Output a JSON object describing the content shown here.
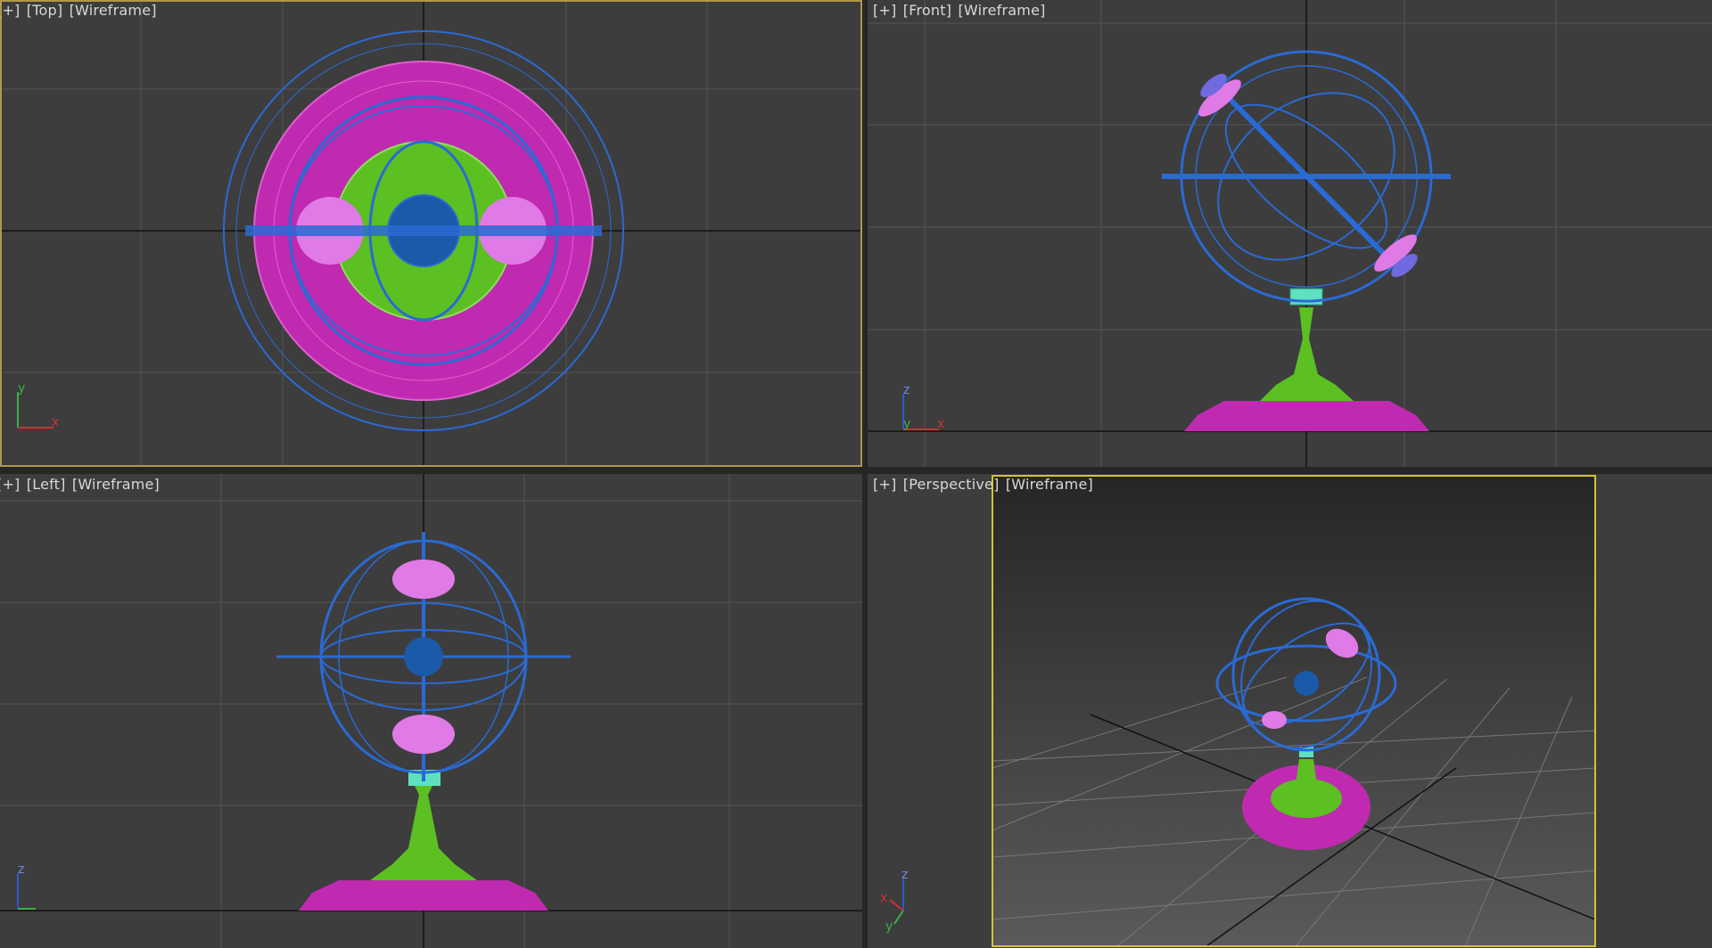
{
  "viewports": {
    "top": {
      "menu": "[+]",
      "view": "[Top]",
      "shading": "[Wireframe]"
    },
    "front": {
      "menu": "[+]",
      "view": "[Front]",
      "shading": "[Wireframe]"
    },
    "left": {
      "menu": "[+]",
      "view": "[Left]",
      "shading": "[Wireframe]"
    },
    "perspective": {
      "menu": "[+]",
      "view": "[Perspective]",
      "shading": "[Wireframe]"
    }
  },
  "axes": {
    "top": {
      "a": "y",
      "b": "x"
    },
    "front": {
      "a": "z",
      "b": "y",
      "c": "x"
    },
    "left": {
      "a": "z"
    },
    "perspective": {
      "a": "z",
      "b": "x",
      "c": "y"
    }
  },
  "colors": {
    "viewport_bg": "#3d3d3d",
    "grid": "#555555",
    "home_grid": "#111111",
    "active_border": "#b3964a",
    "wire_blue": "#2a6ad4",
    "wire_magenta": "#c02ab0",
    "wire_green": "#5cbf22",
    "wire_pink": "#e07ae6",
    "wire_cyan": "#5fe0c0",
    "safe_frame": "#d6c232"
  }
}
